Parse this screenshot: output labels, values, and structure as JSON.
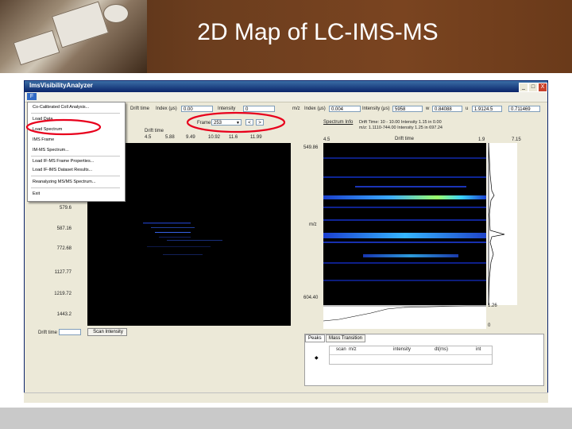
{
  "slide": {
    "title": "2D Map of LC-IMS-MS"
  },
  "window": {
    "title": "ImsVisibilityAnalyzer",
    "controls": [
      "_",
      "□",
      "X"
    ],
    "menu_file": "F"
  },
  "toolbar": {
    "drift_time_label": "Drift time",
    "drift_time_field_label": "Index (μs)",
    "drift_time_value": "0.00",
    "second_field_label": "Intensity",
    "second_field_value": "0",
    "mz_label": "m/z",
    "mz_field_label": "Index (μs)",
    "mz_value": "0.004",
    "intensity_label": "Intensity (μs)",
    "intensity_value": "5958",
    "fw_label": "w",
    "fw_value": "0.84088",
    "tof_label": "u",
    "tof_value": "1.9124.5",
    "res_value": "0.711469"
  },
  "frame_selector": {
    "label": "Frame",
    "value": "253",
    "prev_label": "<",
    "next_label": ">"
  },
  "file_menu": {
    "items": [
      "Co-Calibrated Coll Analysis...",
      "Load Data",
      "Load Spectrum",
      "IMS Frame",
      "IM-MS Spectrum...",
      "Load IF-MS Frame Properties...",
      "Load IF-IMS Dataset Results...",
      "Reanalyzing MS/MS Spectrum...",
      "Exit"
    ]
  },
  "left_plot": {
    "x_label": "Drift time",
    "x_ticks": [
      "4.5",
      "5.88",
      "9.49",
      "10.92",
      "11.6",
      "11.99"
    ],
    "y_ticks": [
      "579.6",
      "587.16",
      "772.68",
      "1127.77",
      "1219.72",
      "1443.2"
    ],
    "drift_time_label": "Drift time",
    "intensity_button": "Scan Intensity"
  },
  "right_plot": {
    "header_left": "Spectrum Info",
    "header_text_1": "Drift Time: 10 - 10.00  Intensity 1.15 in 0.00",
    "header_text_2": "m/z: 1.1110-744.00  Intensity 1.25 in 697.24",
    "x_label": "Drift time",
    "x_tick_left": "4.5",
    "x_tick_right": "1.9",
    "side_tick_top": "7.15",
    "y_label": "m/z",
    "y_tick_top": "549.86",
    "y_tick_bottom": "604.40",
    "bottom_tick_left": "1.26",
    "bottom_tick_right": "0"
  },
  "tabs": {
    "labels": [
      "Peaks",
      "Mass Transition"
    ],
    "columns": [
      "scan",
      "m/z",
      "intensity",
      "dt(ms)",
      "int"
    ]
  },
  "colors": {
    "banner": "#6b3d1e",
    "highlight": "#e8001c",
    "window_title": "#0a246a"
  }
}
